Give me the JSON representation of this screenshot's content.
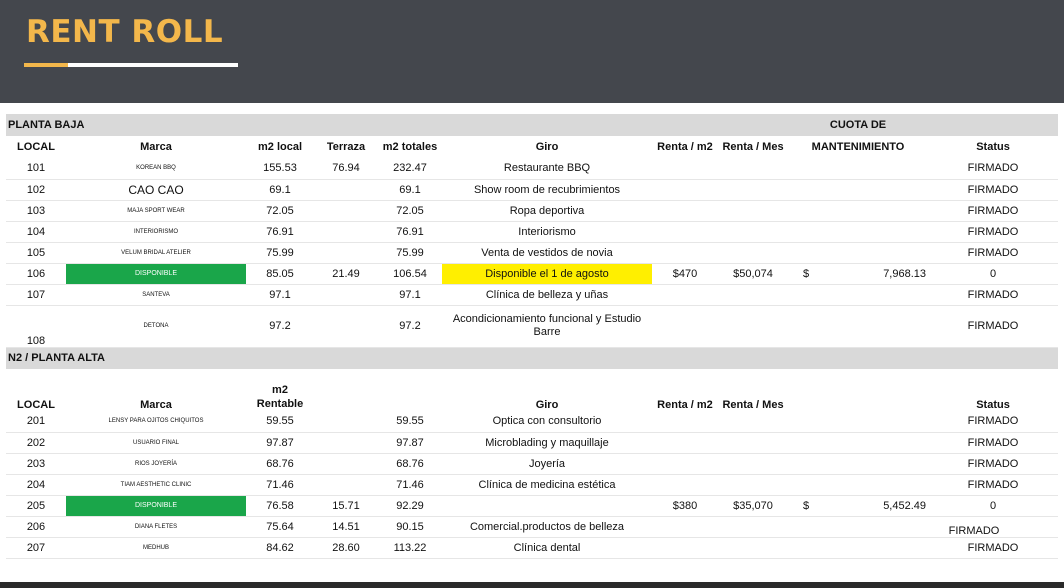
{
  "header": {
    "title": "RENT ROLL"
  },
  "colors": {
    "header_bg": "#44474d",
    "accent": "#f3b74b",
    "available": "#1aa64a",
    "highlight": "#ffef00",
    "section_bg": "#d9d9d9"
  },
  "s1": {
    "name": "PLANTA BAJA",
    "cuota_line1": "CUOTA DE",
    "headers": {
      "local": "LOCAL",
      "marca": "Marca",
      "m2local": "m2 local",
      "terraza": "Terraza",
      "m2totales": "m2 totales",
      "giro": "Giro",
      "renta_m2": "Renta / m2",
      "renta_mes": "Renta / Mes",
      "cuota_line2": "MANTENIMIENTO",
      "status": "Status"
    },
    "rows": [
      {
        "local": "101",
        "marca": "KOREAN BBQ",
        "m2local": "155.53",
        "terraza": "76.94",
        "m2totales": "232.47",
        "giro": "Restaurante BBQ",
        "renta_m2": "",
        "renta_mes": "",
        "cuota_sym": "",
        "cuota": "",
        "status": "FIRMADO"
      },
      {
        "local": "102",
        "marca": "CAO CAO",
        "m2local": "69.1",
        "terraza": "",
        "m2totales": "69.1",
        "giro": "Show room de recubrimientos",
        "renta_m2": "",
        "renta_mes": "",
        "cuota_sym": "",
        "cuota": "",
        "status": "FIRMADO"
      },
      {
        "local": "103",
        "marca": "MAJA SPORT WEAR",
        "m2local": "72.05",
        "terraza": "",
        "m2totales": "72.05",
        "giro": "Ropa deportiva",
        "renta_m2": "",
        "renta_mes": "",
        "cuota_sym": "",
        "cuota": "",
        "status": "FIRMADO"
      },
      {
        "local": "104",
        "marca": "INTERIORISMO",
        "m2local": "76.91",
        "terraza": "",
        "m2totales": "76.91",
        "giro": "Interiorismo",
        "renta_m2": "",
        "renta_mes": "",
        "cuota_sym": "",
        "cuota": "",
        "status": "FIRMADO"
      },
      {
        "local": "105",
        "marca": "VELUM BRIDAL ATELIER",
        "m2local": "75.99",
        "terraza": "",
        "m2totales": "75.99",
        "giro": "Venta de vestidos de novia",
        "renta_m2": "",
        "renta_mes": "",
        "cuota_sym": "",
        "cuota": "",
        "status": "FIRMADO"
      },
      {
        "local": "106",
        "marca": "DISPONIBLE",
        "m2local": "85.05",
        "terraza": "21.49",
        "m2totales": "106.54",
        "giro": "Disponible el 1 de agosto",
        "renta_m2": "$470",
        "renta_mes": "$50,074",
        "cuota_sym": "$",
        "cuota": "7,968.13",
        "status": "0"
      },
      {
        "local": "107",
        "marca": "SANTEVA",
        "m2local": "97.1",
        "terraza": "",
        "m2totales": "97.1",
        "giro": "Clínica de belleza y uñas",
        "renta_m2": "",
        "renta_mes": "",
        "cuota_sym": "",
        "cuota": "",
        "status": "FIRMADO"
      },
      {
        "local": "108",
        "marca": "DETONA",
        "m2local": "97.2",
        "terraza": "",
        "m2totales": "97.2",
        "giro": "Acondicionamiento funcional y Estudio Barre",
        "renta_m2": "",
        "renta_mes": "",
        "cuota_sym": "",
        "cuota": "",
        "status": "FIRMADO"
      }
    ]
  },
  "s2": {
    "name": "N2 / PLANTA ALTA",
    "headers": {
      "local": "LOCAL",
      "marca": "Marca",
      "m2_line1": "m2",
      "m2_line2": "Rentable",
      "giro": "Giro",
      "renta_m2": "Renta / m2",
      "renta_mes": "Renta / Mes",
      "status": "Status"
    },
    "rows": [
      {
        "local": "201",
        "marca": "LENSY PARA OJITOS CHIQUITOS",
        "m2": "59.55",
        "terraza": "",
        "m2totales": "59.55",
        "giro": "Optica con consultorio",
        "renta_m2": "",
        "renta_mes": "",
        "cuota_sym": "",
        "cuota": "",
        "status": "FIRMADO"
      },
      {
        "local": "202",
        "marca": "USUARIO FINAL",
        "m2": "97.87",
        "terraza": "",
        "m2totales": "97.87",
        "giro": "Microblading y maquillaje",
        "renta_m2": "",
        "renta_mes": "",
        "cuota_sym": "",
        "cuota": "",
        "status": "FIRMADO"
      },
      {
        "local": "203",
        "marca": "RIOS JOYERÍA",
        "m2": "68.76",
        "terraza": "",
        "m2totales": "68.76",
        "giro": "Joyería",
        "renta_m2": "",
        "renta_mes": "",
        "cuota_sym": "",
        "cuota": "",
        "status": "FIRMADO"
      },
      {
        "local": "204",
        "marca": "TIAM AESTHETIC CLINIC",
        "m2": "71.46",
        "terraza": "",
        "m2totales": "71.46",
        "giro": "Clínica de medicina estética",
        "renta_m2": "",
        "renta_mes": "",
        "cuota_sym": "",
        "cuota": "",
        "status": "FIRMADO"
      },
      {
        "local": "205",
        "marca": "DISPONIBLE",
        "m2": "76.58",
        "terraza": "15.71",
        "m2totales": "92.29",
        "giro": "",
        "renta_m2": "$380",
        "renta_mes": "$35,070",
        "cuota_sym": "$",
        "cuota": "5,452.49",
        "status": "0"
      },
      {
        "local": "206",
        "marca": "DIANA FLETES",
        "m2": "75.64",
        "terraza": "14.51",
        "m2totales": "90.15",
        "giro": "Comercial.productos de belleza",
        "renta_m2": "",
        "renta_mes": "",
        "cuota_sym": "",
        "cuota": "",
        "status": "FIRMADO"
      },
      {
        "local": "207",
        "marca": "MEDHUB",
        "m2": "84.62",
        "terraza": "28.60",
        "m2totales": "113.22",
        "giro": "Clínica dental",
        "renta_m2": "",
        "renta_mes": "",
        "cuota_sym": "",
        "cuota": "",
        "status": "FIRMADO"
      }
    ]
  }
}
